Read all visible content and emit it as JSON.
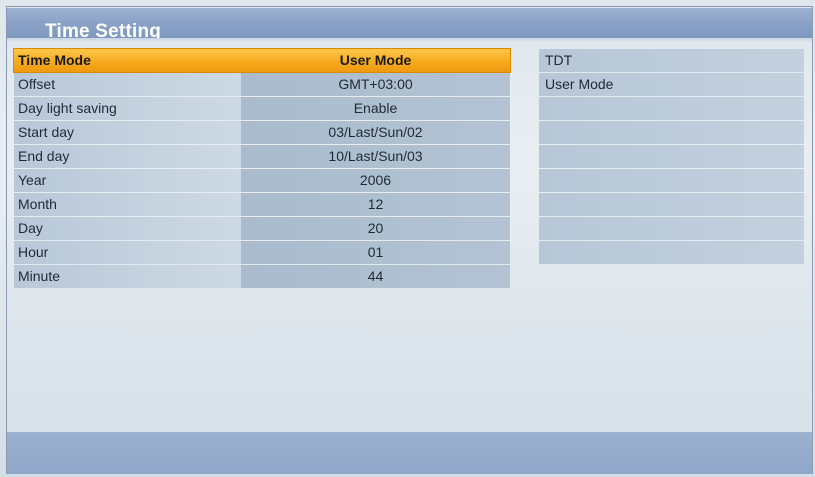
{
  "window": {
    "title": "Time Setting"
  },
  "settings": [
    {
      "label": "Time Mode",
      "value": "User Mode",
      "selected": true
    },
    {
      "label": "Offset",
      "value": "GMT+03:00",
      "selected": false
    },
    {
      "label": "Day light saving",
      "value": "Enable",
      "selected": false
    },
    {
      "label": "Start day",
      "value": "03/Last/Sun/02",
      "selected": false
    },
    {
      "label": "End day",
      "value": "10/Last/Sun/03",
      "selected": false
    },
    {
      "label": "Year",
      "value": "2006",
      "selected": false
    },
    {
      "label": "Month",
      "value": "12",
      "selected": false
    },
    {
      "label": "Day",
      "value": "20",
      "selected": false
    },
    {
      "label": "Hour",
      "value": "01",
      "selected": false
    },
    {
      "label": "Minute",
      "value": "44",
      "selected": false
    }
  ],
  "options": [
    {
      "label": "TDT"
    },
    {
      "label": "User Mode"
    },
    {
      "label": ""
    },
    {
      "label": ""
    },
    {
      "label": ""
    },
    {
      "label": ""
    },
    {
      "label": ""
    },
    {
      "label": ""
    },
    {
      "label": ""
    }
  ],
  "colors": {
    "highlight": "#f6ab1f",
    "title_bar": "#8aa2c7",
    "row_label": "#c4d2df",
    "row_value": "#b3c3d3",
    "background": "#e3eaef"
  }
}
